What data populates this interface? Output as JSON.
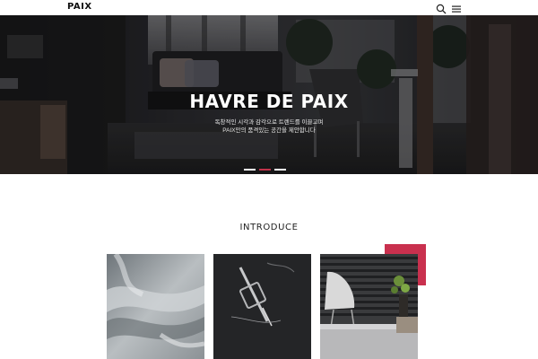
{
  "header": {
    "logo": "PAIX",
    "search_icon": "search-icon",
    "menu_icon": "hamburger-menu-icon"
  },
  "hero": {
    "title": "HAVRE DE PAIX",
    "subtitle_line1": "독창적인 시각과 감각으로 트렌드를 이끌고며",
    "subtitle_line2": "PAIX만의 품격있는 공간을 제안합니다",
    "slides_total": 3,
    "active_slide": 2
  },
  "introduce": {
    "title": "INTRODUCE",
    "cards": [
      {
        "image": "grey-fabric-folds"
      },
      {
        "image": "sewing-machine-needle"
      },
      {
        "image": "white-chair-window-blinds"
      }
    ]
  },
  "colors": {
    "accent": "#c9304e",
    "dot_active": "#c2334a",
    "text_dark": "#222222"
  }
}
